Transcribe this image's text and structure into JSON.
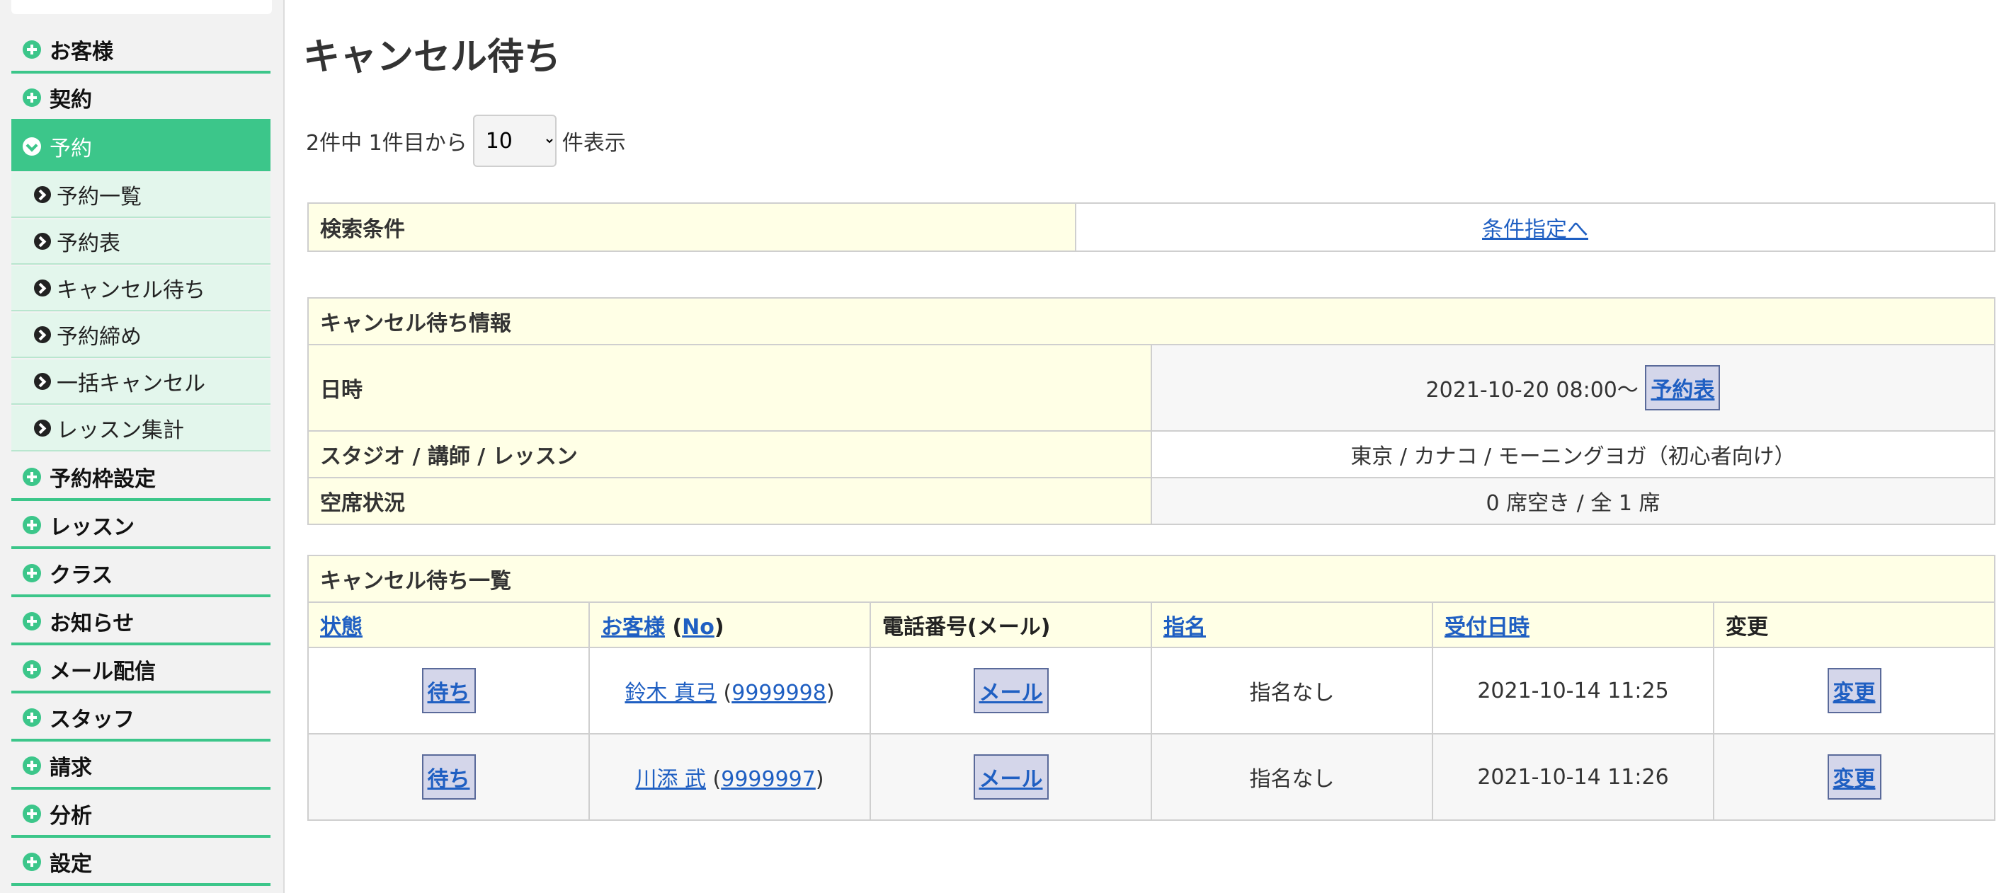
{
  "sidebar": {
    "items_before": [
      {
        "label": "お客様"
      },
      {
        "label": "契約"
      }
    ],
    "active": {
      "label": "予約"
    },
    "sub_items": [
      {
        "label": "予約一覧"
      },
      {
        "label": "予約表"
      },
      {
        "label": "キャンセル待ち"
      },
      {
        "label": "予約締め"
      },
      {
        "label": "一括キャンセル"
      },
      {
        "label": "レッスン集計"
      }
    ],
    "items_after": [
      {
        "label": "予約枠設定"
      },
      {
        "label": "レッスン"
      },
      {
        "label": "クラス"
      },
      {
        "label": "お知らせ"
      },
      {
        "label": "メール配信"
      },
      {
        "label": "スタッフ"
      },
      {
        "label": "請求"
      },
      {
        "label": "分析"
      },
      {
        "label": "設定"
      }
    ]
  },
  "page": {
    "title": "キャンセル待ち",
    "pager_prefix": "2件中 1件目から",
    "page_size": "10",
    "pager_suffix": "件表示"
  },
  "search": {
    "label": "検索条件",
    "link": "条件指定へ"
  },
  "info": {
    "title": "キャンセル待ち情報",
    "datetime_label": "日時",
    "datetime_value": "2021-10-20 08:00〜",
    "schedule_button": "予約表",
    "studio_label": "スタジオ / 講師 / レッスン",
    "studio_value": "東京 / カナコ / モーニングヨガ（初心者向け）",
    "seats_label": "空席状況",
    "seats_value": "0 席空き / 全 1 席"
  },
  "list": {
    "title": "キャンセル待ち一覧",
    "headers": {
      "status": "状態",
      "customer": "お客様",
      "customer_no": "No",
      "phone": "電話番号(メール)",
      "nomination": "指名",
      "received": "受付日時",
      "change": "変更"
    },
    "rows": [
      {
        "status": "待ち",
        "name": "鈴木 真弓",
        "no": "9999998",
        "mail": "メール",
        "nomination": "指名なし",
        "received": "2021-10-14 11:25",
        "change": "変更"
      },
      {
        "status": "待ち",
        "name": "川添 武",
        "no": "9999997",
        "mail": "メール",
        "nomination": "指名なし",
        "received": "2021-10-14 11:26",
        "change": "変更"
      }
    ]
  },
  "colors": {
    "accent": "#3cc68a",
    "header_bg": "#ffffe6",
    "link": "#1f5fc2"
  }
}
